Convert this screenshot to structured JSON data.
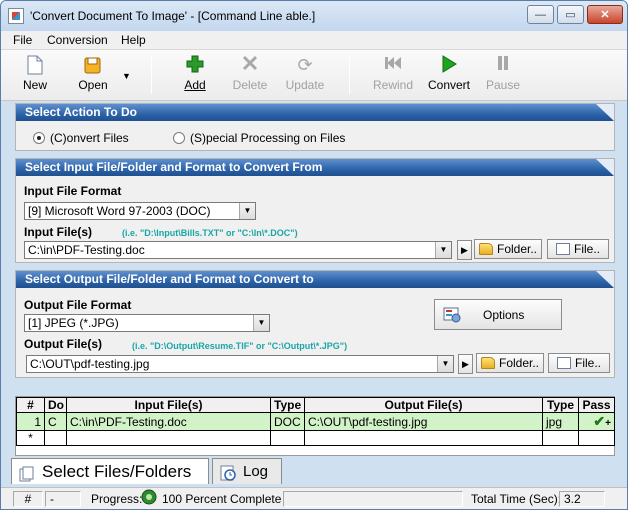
{
  "window": {
    "title": "'Convert Document To Image' - [Command Line able.]",
    "min_glyph": "—",
    "max_glyph": "▭",
    "close_glyph": "✕"
  },
  "menu": {
    "items": [
      "File",
      "Conversion",
      "Help"
    ]
  },
  "toolbar": {
    "new": "New",
    "open": "Open",
    "add": "Add",
    "delete": "Delete",
    "update": "Update",
    "rewind": "Rewind",
    "convert": "Convert",
    "pause": "Pause"
  },
  "action_panel": {
    "header": "Select Action To Do",
    "convert_files": "(C)onvert Files",
    "special_processing": "(S)pecial Processing on Files",
    "selected": "convert_files"
  },
  "input_panel": {
    "header": "Select Input File/Folder and Format to Convert From",
    "format_label": "Input File Format",
    "format_value": "[9] Microsoft Word 97-2003 (DOC)",
    "file_label": "Input File(s)",
    "file_hint": "(i.e. \"D:\\Input\\Bills.TXT\"  or \"C:\\In\\*.DOC\")",
    "file_value": "C:\\in\\PDF-Testing.doc",
    "folder_button": "Folder..",
    "file_button": "File.."
  },
  "output_panel": {
    "header": "Select Output File/Folder and Format to Convert to",
    "format_label": "Output File Format",
    "format_value": "[1] JPEG (*.JPG)",
    "options_button": "Options",
    "file_label": "Output File(s)",
    "file_hint": "(i.e. \"D:\\Output\\Resume.TIF\" or \"C:\\Output\\*.JPG\")",
    "file_value": "C:\\OUT\\pdf-testing.jpg",
    "folder_button": "Folder..",
    "file_button": "File.."
  },
  "grid": {
    "columns": [
      "#",
      "Do",
      "Input File(s)",
      "Type",
      "Output File(s)",
      "Type",
      "Pass"
    ],
    "rows": [
      [
        "1",
        "C",
        "C:\\in\\PDF-Testing.doc",
        "DOC",
        "C:\\OUT\\pdf-testing.jpg",
        "jpg",
        "+"
      ],
      [
        "*",
        "",
        "",
        "",
        "",
        "",
        ""
      ]
    ]
  },
  "tabs": {
    "files": "Select Files/Folders",
    "log": "Log"
  },
  "status": {
    "hash": "#",
    "dash": "-",
    "progress_label": "Progress:",
    "progress_text": "100 Percent Complete",
    "time_label": "Total Time (Sec):",
    "time_value": "3.2"
  },
  "colors": {
    "panel_header": "#2d63a8",
    "hint": "#1aa6a6",
    "selected_row": "#d2f2c8",
    "add_icon": "#2a9a2a",
    "convert_icon": "#1ea51e"
  },
  "icons": {
    "new": "new-document-icon",
    "open": "open-folder-icon",
    "add": "plus-icon",
    "delete": "x-icon",
    "update": "refresh-icon",
    "rewind": "rewind-icon",
    "convert": "play-icon",
    "pause": "pause-icon",
    "options": "options-icon",
    "pass": "checkmark-icon"
  }
}
